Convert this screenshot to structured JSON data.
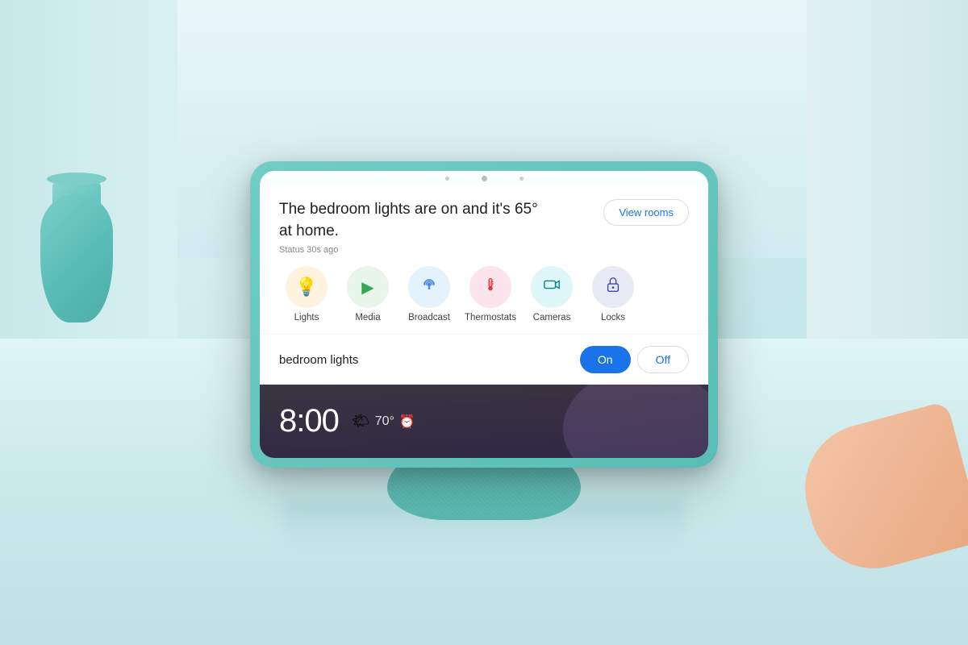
{
  "background": {
    "color": "#d8eff0"
  },
  "device": {
    "screen": {
      "main_message": "The bedroom lights are on and it's 65° at home.",
      "status_text": "Status 30s ago",
      "view_rooms_label": "View rooms",
      "icons": [
        {
          "id": "lights",
          "label": "Lights",
          "icon": "💡",
          "circle_class": "lights"
        },
        {
          "id": "media",
          "label": "Media",
          "icon": "▶",
          "circle_class": "media"
        },
        {
          "id": "broadcast",
          "label": "Broadcast",
          "icon": "📢",
          "circle_class": "broadcast"
        },
        {
          "id": "thermostats",
          "label": "Thermostats",
          "icon": "🌡",
          "circle_class": "thermostats"
        },
        {
          "id": "cameras",
          "label": "Cameras",
          "icon": "📷",
          "circle_class": "cameras"
        },
        {
          "id": "locks",
          "label": "Locks",
          "icon": "🔒",
          "circle_class": "locks"
        }
      ],
      "control_label": "bedroom lights",
      "on_label": "On",
      "off_label": "Off",
      "clock_time": "8:00",
      "weather_icon": "🌤",
      "weather_temp": "70°",
      "alarm_icon": "⏰"
    }
  }
}
